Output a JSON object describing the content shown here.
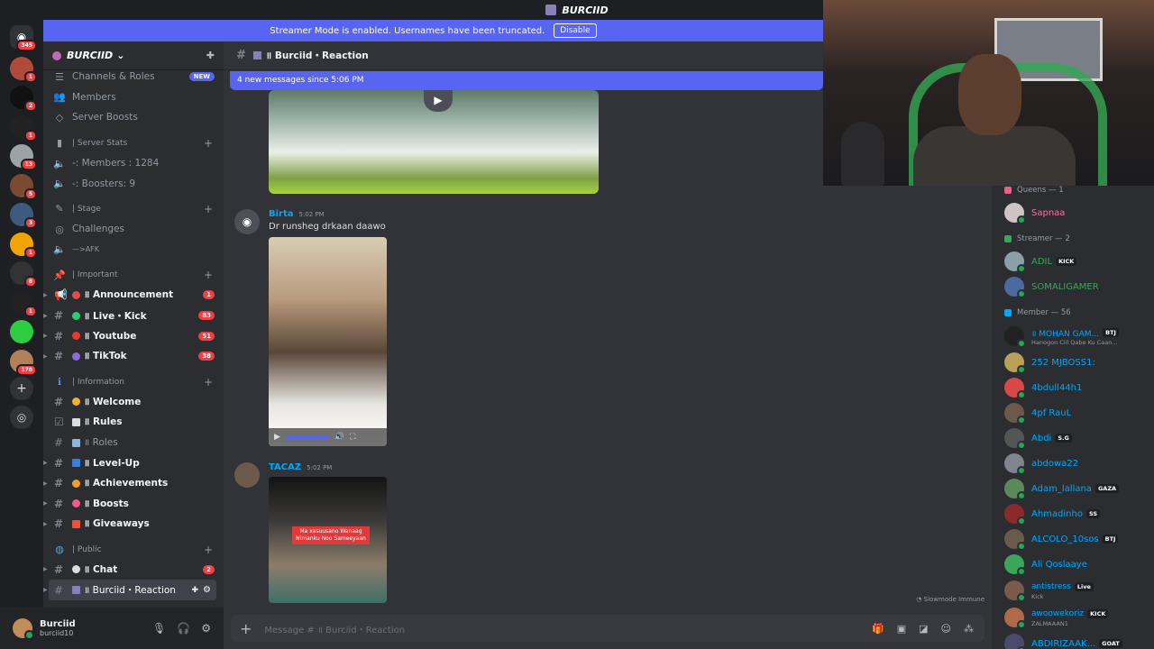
{
  "window": {
    "title": "BURCIID"
  },
  "streamer_banner": {
    "text": "Streamer Mode is enabled. Usernames have been truncated.",
    "disable_label": "Disable"
  },
  "guilds": [
    {
      "badge": "345",
      "color": "#5865f2"
    },
    {
      "badge": "1",
      "color": "#b04a3a"
    },
    {
      "badge": "2",
      "color": "#111111"
    },
    {
      "badge": "1",
      "color": "#222222"
    },
    {
      "badge": "13",
      "color": "#9aa3a8"
    },
    {
      "badge": "5",
      "color": "#7a4a33"
    },
    {
      "badge": "3",
      "color": "#3d5a80"
    },
    {
      "badge": "1",
      "color": "#f0a500"
    },
    {
      "badge": "8",
      "color": "#333333"
    },
    {
      "badge": "1",
      "color": "#222222"
    },
    {
      "badge": "",
      "color": "#2ecc40"
    },
    {
      "badge": "178",
      "color": "#b0805a"
    }
  ],
  "sidebar": {
    "server_name": "BURCIID",
    "channels_roles": "Channels & Roles",
    "new_badge": "NEW",
    "members": "Members",
    "server_boosts": "Server Boosts",
    "cat_stats": "| Server Stats",
    "stat_members": "-: Members : 1284",
    "stat_boosters": "-: Boosters: 9",
    "cat_stage": "| Stage",
    "challenges": "Challenges",
    "afk": "—>AFK",
    "cat_important": "| Important",
    "ch_announcement": "॥ Announcement",
    "cnt_announcement": "1",
    "ch_live": "॥ Live・Kick",
    "cnt_live": "83",
    "ch_youtube": "॥ Youtube",
    "cnt_youtube": "51",
    "ch_tiktok": "॥ TikTok",
    "cnt_tiktok": "38",
    "cat_information": "| Information",
    "ch_welcome": "॥ Welcome",
    "ch_rules": "॥ Rules",
    "ch_roles": "॥ Roles",
    "ch_levelup": "॥ Level-Up",
    "ch_achievements": "॥ Achievements",
    "ch_boosts": "॥ Boosts",
    "ch_giveaways": "॥ Giveaways",
    "cat_public": "| Public",
    "ch_chat": "॥ Chat",
    "cnt_chat": "2",
    "ch_burciid": "॥ Burciid・Reaction"
  },
  "user": {
    "name": "Burciid",
    "tag": "burciid10"
  },
  "channel_header": {
    "title": "॥ Burciid・Reaction"
  },
  "new_messages": {
    "text": "4 new messages since 5:06 PM"
  },
  "messages": [
    {
      "author": "Birta",
      "time": "5:02 PM",
      "text": "Dr runsheg drkaan daawo"
    },
    {
      "author": "TACAZ",
      "time": "5:02 PM",
      "caption": "Ma xasuusano Wanaag Nimanku Noo Sameeyaan"
    }
  ],
  "composer": {
    "placeholder": "Message # ॥ Burciid・Reaction",
    "slowmode": "Slowmode Immune"
  },
  "members": {
    "cat_queens": "Queens — 1",
    "cat_streamer": "Streamer — 2",
    "cat_member": "Member — 56",
    "list_queens": [
      {
        "name": "Sapnaa",
        "color": "#ff6ea8",
        "avatar": "#cfc4c4"
      }
    ],
    "list_streamer": [
      {
        "name": "ADIL",
        "tag": "KICK",
        "color": "#3ba55c",
        "avatar": "#8aa0a8"
      },
      {
        "name": "SOMALIGAMER",
        "tag": "",
        "color": "#3ba55c",
        "avatar": "#4a6aa0"
      }
    ],
    "list_member": [
      {
        "name": "॥ MOHAN GAM...",
        "tag": "BTJ",
        "sub": "Hanogon Ciil Qabe Ku Caan...",
        "color": "#00a8fc",
        "avatar": "#222222"
      },
      {
        "name": "252 MJBOSS1:",
        "tag": "",
        "sub": "",
        "color": "#00a8fc",
        "avatar": "#b8a15a"
      },
      {
        "name": "4bdull44h1",
        "tag": "",
        "sub": "",
        "color": "#00a8fc",
        "avatar": "#d94848"
      },
      {
        "name": "4pf RauL",
        "tag": "",
        "sub": "",
        "color": "#00a8fc",
        "avatar": "#6b5a4a"
      },
      {
        "name": "Abdi",
        "tag": "S.G",
        "sub": "",
        "color": "#00a8fc",
        "avatar": "#555555"
      },
      {
        "name": "abdowa22",
        "tag": "",
        "sub": "",
        "color": "#00a8fc",
        "avatar": "#80848e"
      },
      {
        "name": "Adam_lallana",
        "tag": "GAZA",
        "sub": "",
        "color": "#00a8fc",
        "avatar": "#5a8a5a"
      },
      {
        "name": "Ahmadinho",
        "tag": "SS",
        "sub": "",
        "color": "#00a8fc",
        "avatar": "#8a2a2a"
      },
      {
        "name": "ALCOLO_10sos",
        "tag": "BTJ",
        "sub": "",
        "color": "#00a8fc",
        "avatar": "#6a5a4a"
      },
      {
        "name": "Ali Qoslaaye",
        "tag": "",
        "sub": "",
        "color": "#00a8fc",
        "avatar": "#3ba55c"
      },
      {
        "name": "antistress",
        "tag": "Live",
        "sub": "Kick",
        "color": "#00a8fc",
        "avatar": "#7a5a4a"
      },
      {
        "name": "awoowekoriz",
        "tag": "KICK",
        "sub": "ZALMAAAN1",
        "color": "#00a8fc",
        "avatar": "#b06a4a"
      },
      {
        "name": "ABDIRIZAAK...",
        "tag": "GOAT",
        "sub": "",
        "color": "#00a8fc",
        "avatar": "#4a4a6a"
      }
    ]
  }
}
